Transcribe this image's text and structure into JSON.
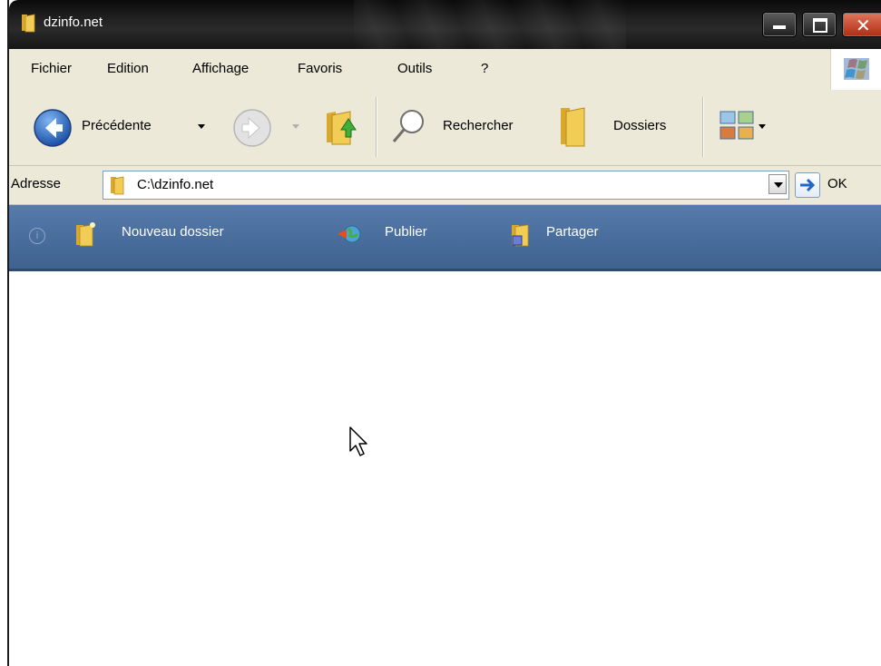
{
  "window": {
    "title": "dzinfo.net"
  },
  "menu": [
    "Fichier",
    "Edition",
    "Affichage",
    "Favoris",
    "Outils",
    "?"
  ],
  "toolbar": {
    "back_label": "Précédente",
    "search_label": "Rechercher",
    "folders_label": "Dossiers"
  },
  "address": {
    "label": "Adresse",
    "value": "C:\\dzinfo.net",
    "go_label": "OK"
  },
  "tasks": {
    "new_folder": "Nouveau dossier",
    "publish": "Publier",
    "share": "Partager"
  },
  "colors": {
    "taskbar": "#4b6f9e",
    "titlebar": "#1a1a1a",
    "menubar": "#ece9d8",
    "close": "#c8432a"
  }
}
